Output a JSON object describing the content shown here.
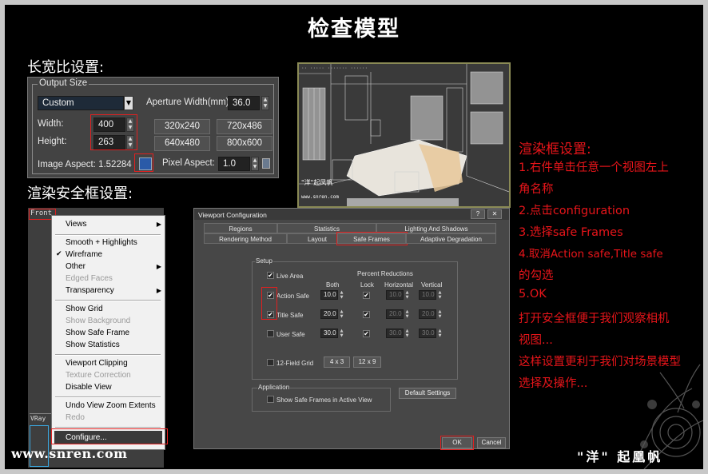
{
  "title": "检查模型",
  "aspect_heading": "长宽比设置:",
  "safe_heading": "渲染安全框设置:",
  "output_size": {
    "group_label": "Output Size",
    "preset": "Custom",
    "aperture_label": "Aperture Width(mm):",
    "aperture_value": "36.0",
    "width_label": "Width:",
    "width_value": "400",
    "height_label": "Height:",
    "height_value": "263",
    "presets": [
      "320x240",
      "720x486",
      "640x480",
      "800x600"
    ],
    "image_aspect_label": "Image Aspect: 1.52284",
    "pixel_aspect_label": "Pixel Aspect:",
    "pixel_aspect_value": "1.0"
  },
  "render_view": {
    "overlay_logo": "\"洋\"起凤帆",
    "overlay_url": "www.snren.com"
  },
  "instructions": {
    "heading": "渲染框设置:",
    "lines": [
      "1.右件单击任意一个视图左上",
      "角名称",
      "2.点击configuration",
      "3.选择safe Frames",
      "4.取消Action safe,Title safe",
      "的勾选",
      "5.OK",
      "打开安全框便于我们观察相机",
      "视图...",
      "这样设置更利于我们对场景模型",
      "选择及操作..."
    ]
  },
  "viewport": {
    "front_label": "Front",
    "bottom_label": "VRay"
  },
  "context_menu": {
    "items": [
      {
        "label": "Views",
        "submenu": true
      },
      {
        "label": "Smooth + Highlights"
      },
      {
        "label": "Wireframe",
        "checked": true
      },
      {
        "label": "Other",
        "submenu": true
      },
      {
        "label": "Edged Faces",
        "disabled": true
      },
      {
        "label": "Transparency",
        "submenu": true
      },
      {
        "label": "Show Grid"
      },
      {
        "label": "Show Background",
        "disabled": true
      },
      {
        "label": "Show Safe Frame"
      },
      {
        "label": "Show Statistics"
      },
      {
        "label": "Viewport Clipping"
      },
      {
        "label": "Texture Correction",
        "disabled": true
      },
      {
        "label": "Disable View"
      },
      {
        "label": "Undo View Zoom Extents"
      },
      {
        "label": "Redo",
        "disabled": true
      },
      {
        "label": "Configure..."
      }
    ],
    "checkmark": "✔",
    "submenu_arrow": "▶"
  },
  "dialog": {
    "title": "Viewport Configuration",
    "help_glyph": "?",
    "close_glyph": "✕",
    "tabs_row1": [
      "Regions",
      "Statistics",
      "Lighting And Shadows"
    ],
    "tabs_row2": [
      "Rendering Method",
      "Layout",
      "Safe Frames",
      "Adaptive Degradation"
    ],
    "setup_label": "Setup",
    "percent_reductions": "Percent Reductions",
    "col_both": "Both",
    "col_lock": "Lock",
    "col_horizontal": "Horizontal",
    "col_vertical": "Vertical",
    "live_area": "Live Area",
    "action_safe": "Action Safe",
    "title_safe": "Title Safe",
    "user_safe": "User Safe",
    "action_both": "10.0",
    "action_h": "10.0",
    "action_v": "10.0",
    "title_both": "20.0",
    "title_h": "20.0",
    "title_v": "20.0",
    "user_both": "30.0",
    "user_h": "30.0",
    "user_v": "30.0",
    "grid_label": "12-Field Grid",
    "grid_4x3": "4 x 3",
    "grid_12x9": "12 x 9",
    "application_label": "Application",
    "show_safe_frames_active": "Show Safe Frames in Active View",
    "default_settings": "Default Settings",
    "ok": "OK",
    "cancel": "Cancel"
  },
  "footer": {
    "url": "www.snren.com",
    "author": "\"洋\" 起凰帆"
  }
}
